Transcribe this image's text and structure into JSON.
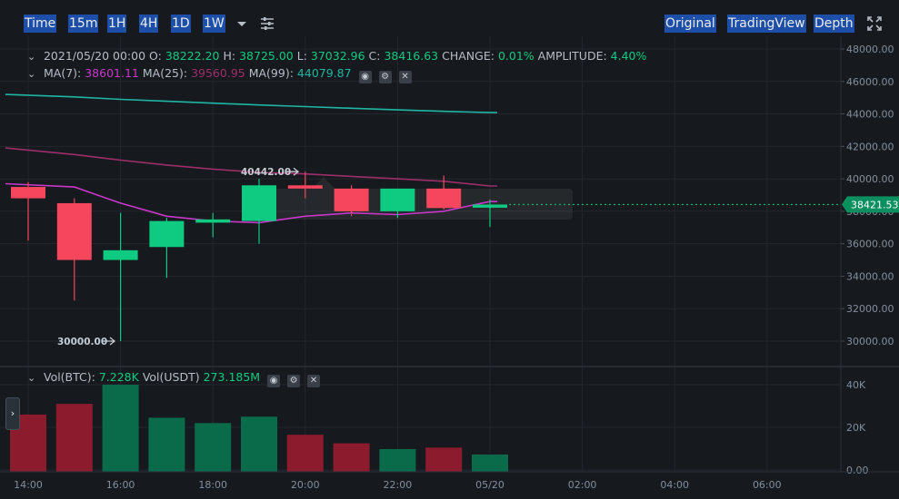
{
  "toolbar": {
    "intervals": [
      "Time",
      "15m",
      "1H",
      "4H",
      "1D",
      "1W"
    ],
    "views": [
      "Original",
      "TradingView",
      "Depth"
    ]
  },
  "ohlc_info": {
    "date": "2021/05/20 00:00",
    "o_label": "O:",
    "o": "38222.20",
    "h_label": "H:",
    "h": "38725.00",
    "l_label": "L:",
    "l": "37032.96",
    "c_label": "C:",
    "c": "38416.63",
    "change_label": "CHANGE:",
    "change": "0.01%",
    "amplitude_label": "AMPLITUDE:",
    "amplitude": "4.40%"
  },
  "ma_info": {
    "ma7_label": "MA(7):",
    "ma7": "38601.11",
    "ma25_label": "MA(25):",
    "ma25": "39560.95",
    "ma99_label": "MA(99):",
    "ma99": "44079.87"
  },
  "vol_info": {
    "btc_label": "Vol(BTC):",
    "btc": "7.228K",
    "usdt_label": "Vol(USDT)",
    "usdt": "273.185M"
  },
  "colors": {
    "up": "#0ecb81",
    "down": "#f6465d",
    "up_vol": "#0a6b4b",
    "down_vol": "#8d1b2e",
    "ma7": "#c837ca",
    "ma25": "#9c2e6a",
    "ma99": "#1fb6a3",
    "grid": "#23272d",
    "axis_text": "#848e9c"
  },
  "chart_data": [
    {
      "type": "candlestick",
      "x_tick_labels": [
        "14:00",
        "16:00",
        "18:00",
        "20:00",
        "22:00",
        "05/20",
        "02:00",
        "04:00",
        "06:00"
      ],
      "y_tick_labels": [
        "48000.00",
        "46000.00",
        "44000.00",
        "42000.00",
        "40000.00",
        "38000.00",
        "36000.00",
        "34000.00",
        "32000.00",
        "30000.00"
      ],
      "ylim": [
        28500,
        48500
      ],
      "candles": [
        {
          "o": 39500,
          "h": 39800,
          "l": 36200,
          "c": 38800
        },
        {
          "o": 38500,
          "h": 38800,
          "l": 32500,
          "c": 35000
        },
        {
          "o": 35000,
          "h": 37900,
          "l": 30000,
          "c": 35600
        },
        {
          "o": 35800,
          "h": 37600,
          "l": 33900,
          "c": 37400
        },
        {
          "o": 37300,
          "h": 37900,
          "l": 36400,
          "c": 37500
        },
        {
          "o": 37400,
          "h": 40000,
          "l": 36000,
          "c": 39600
        },
        {
          "o": 39600,
          "h": 40442,
          "l": 38800,
          "c": 39400
        },
        {
          "o": 39400,
          "h": 39600,
          "l": 37700,
          "c": 38000
        },
        {
          "o": 38000,
          "h": 39300,
          "l": 37600,
          "c": 39400
        },
        {
          "o": 39400,
          "h": 40200,
          "l": 38100,
          "c": 38200
        },
        {
          "o": 38222.2,
          "h": 38725,
          "l": 37032.96,
          "c": 38416.63
        }
      ],
      "ma7": [
        39700,
        39500,
        38500,
        37700,
        37400,
        37300,
        37700,
        37900,
        37800,
        38000,
        38601.11
      ],
      "ma25": [
        41900,
        41500,
        41150,
        40850,
        40600,
        40400,
        40300,
        40150,
        40000,
        39850,
        39560.95
      ],
      "ma99": [
        45200,
        45050,
        44900,
        44780,
        44660,
        44550,
        44450,
        44350,
        44250,
        44160,
        44079.87
      ],
      "annotations": [
        {
          "text": "40442.00",
          "value": 40442
        },
        {
          "text": "30000.00",
          "value": 30000
        }
      ],
      "last_price": {
        "value": 38421.53,
        "label": "38421.53"
      }
    },
    {
      "type": "bar",
      "name": "Vol(BTC)",
      "y_tick_labels": [
        "40K",
        "20K",
        "0.00"
      ],
      "ylim": [
        0,
        42000
      ],
      "values": [
        26000,
        31000,
        40000,
        24500,
        22000,
        25000,
        16500,
        12500,
        9800,
        10500,
        7228
      ]
    }
  ]
}
